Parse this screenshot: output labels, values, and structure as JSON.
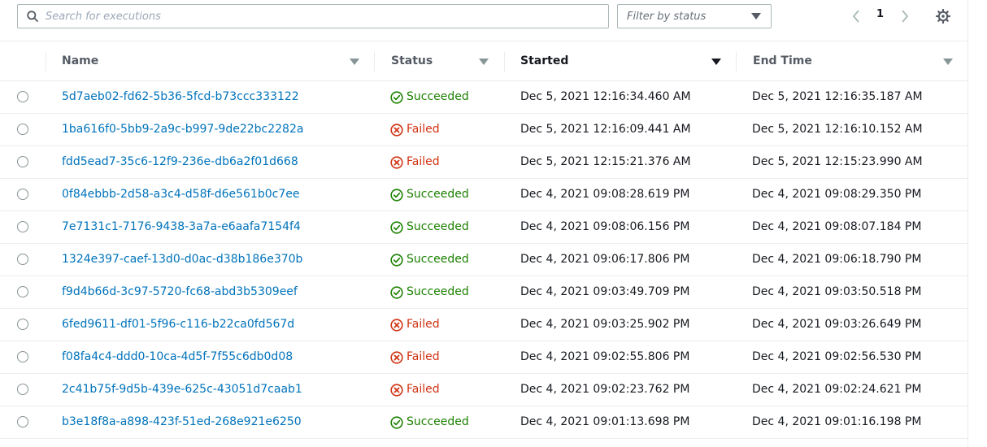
{
  "toolbar": {
    "search_placeholder": "Search for executions",
    "filter_label": "Filter by status",
    "page": "1"
  },
  "columns": [
    {
      "label": "Name",
      "sorted": false
    },
    {
      "label": "Status",
      "sorted": false
    },
    {
      "label": "Started",
      "sorted": true
    },
    {
      "label": "End Time",
      "sorted": false
    }
  ],
  "status_colors": {
    "Succeeded": "#1d8102",
    "Failed": "#d13212"
  },
  "rows": [
    {
      "name": "5d7aeb02-fd62-5b36-5fcd-b73ccc333122",
      "status": "Succeeded",
      "started": "Dec 5, 2021 12:16:34.460 AM",
      "end": "Dec 5, 2021 12:16:35.187 AM"
    },
    {
      "name": "1ba616f0-5bb9-2a9c-b997-9de22bc2282a",
      "status": "Failed",
      "started": "Dec 5, 2021 12:16:09.441 AM",
      "end": "Dec 5, 2021 12:16:10.152 AM"
    },
    {
      "name": "fdd5ead7-35c6-12f9-236e-db6a2f01d668",
      "status": "Failed",
      "started": "Dec 5, 2021 12:15:21.376 AM",
      "end": "Dec 5, 2021 12:15:23.990 AM"
    },
    {
      "name": "0f84ebbb-2d58-a3c4-d58f-d6e561b0c7ee",
      "status": "Succeeded",
      "started": "Dec 4, 2021 09:08:28.619 PM",
      "end": "Dec 4, 2021 09:08:29.350 PM"
    },
    {
      "name": "7e7131c1-7176-9438-3a7a-e6aafa7154f4",
      "status": "Succeeded",
      "started": "Dec 4, 2021 09:08:06.156 PM",
      "end": "Dec 4, 2021 09:08:07.184 PM"
    },
    {
      "name": "1324e397-caef-13d0-d0ac-d38b186e370b",
      "status": "Succeeded",
      "started": "Dec 4, 2021 09:06:17.806 PM",
      "end": "Dec 4, 2021 09:06:18.790 PM"
    },
    {
      "name": "f9d4b66d-3c97-5720-fc68-abd3b5309eef",
      "status": "Succeeded",
      "started": "Dec 4, 2021 09:03:49.709 PM",
      "end": "Dec 4, 2021 09:03:50.518 PM"
    },
    {
      "name": "6fed9611-df01-5f96-c116-b22ca0fd567d",
      "status": "Failed",
      "started": "Dec 4, 2021 09:03:25.902 PM",
      "end": "Dec 4, 2021 09:03:26.649 PM"
    },
    {
      "name": "f08fa4c4-ddd0-10ca-4d5f-7f55c6db0d08",
      "status": "Failed",
      "started": "Dec 4, 2021 09:02:55.806 PM",
      "end": "Dec 4, 2021 09:02:56.530 PM"
    },
    {
      "name": "2c41b75f-9d5b-439e-625c-43051d7caab1",
      "status": "Failed",
      "started": "Dec 4, 2021 09:02:23.762 PM",
      "end": "Dec 4, 2021 09:02:24.621 PM"
    },
    {
      "name": "b3e18f8a-a898-423f-51ed-268e921e6250",
      "status": "Succeeded",
      "started": "Dec 4, 2021 09:01:13.698 PM",
      "end": "Dec 4, 2021 09:01:16.198 PM"
    }
  ]
}
